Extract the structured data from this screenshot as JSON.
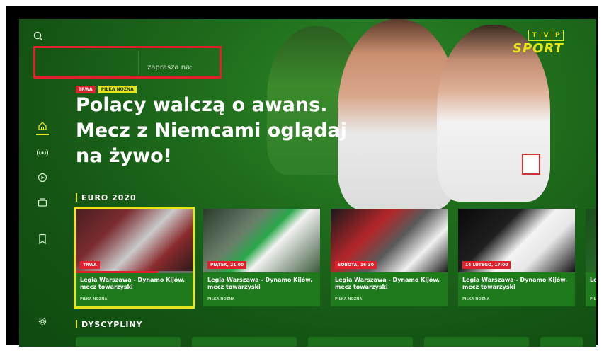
{
  "brand": {
    "tvp_letters": [
      "T",
      "V",
      "P"
    ],
    "sport_text": "SPORT",
    "accent": "#e6e51a",
    "background": "#1f6d1c",
    "highlight": "#e0202a"
  },
  "hero": {
    "invite_text": "zaprasza na:",
    "tags": [
      "TRWA",
      "PIŁKA NOŻNA"
    ],
    "headline": "Polacy walczą o awans. Mecz z Niemcami oglądaj na żywo!"
  },
  "sidebar": {
    "items": [
      {
        "name": "home-icon",
        "active": true
      },
      {
        "name": "live-icon",
        "active": false
      },
      {
        "name": "play-icon",
        "active": false
      },
      {
        "name": "tv-icon",
        "active": false
      },
      {
        "name": "bookmark-icon",
        "active": false
      },
      {
        "name": "settings-icon",
        "active": false
      }
    ]
  },
  "sections": {
    "euro_title": "EURO 2020",
    "disciplines_title": "DYSCYPLINY"
  },
  "cards": [
    {
      "badge": "TRWA",
      "title": "Legia Warszawa - Dynamo Kijów, mecz towarzyski",
      "subtitle": "PIŁKA NOŻNA",
      "progress": 0.7
    },
    {
      "badge": "PIĄTEK, 21:00",
      "title": "Legia Warszawa - Dynamo Kijów, mecz towarzyski",
      "subtitle": "PIŁKA NOŻNA"
    },
    {
      "badge": "SOBOTA, 16:30",
      "title": "Legia Warszawa - Dynamo Kijów, mecz towarzyski",
      "subtitle": "PIŁKA NOŻNA"
    },
    {
      "badge": "14 LUTEGO, 17:00",
      "title": "Legia Warszawa - Dynamo Kijów, mecz towarzyski",
      "subtitle": "PIŁKA NOŻNA"
    },
    {
      "badge": "",
      "title": "Leg",
      "subtitle": "PIŁ"
    }
  ]
}
